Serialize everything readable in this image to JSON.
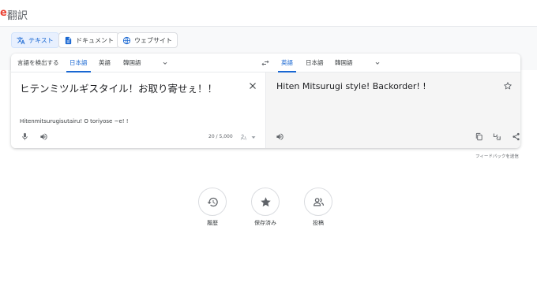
{
  "header": {
    "logo_letter": "e",
    "logo_text": "翻訳"
  },
  "modes": [
    {
      "label": "テキスト",
      "icon": "translate-icon",
      "active": true
    },
    {
      "label": "ドキュメント",
      "icon": "document-icon",
      "active": false
    },
    {
      "label": "ウェブサイト",
      "icon": "globe-icon",
      "active": false
    }
  ],
  "source_langs": [
    "言語を検出する",
    "日本語",
    "英語",
    "韓国語"
  ],
  "target_langs": [
    "英語",
    "日本語",
    "韓国語"
  ],
  "source": {
    "text": "ヒテンミツルギスタイル！お取り寄せぇ！！",
    "romanization": "Hitenmitsurugisutairu! O toriyose ~e! !",
    "char_count": "20 / 5,000"
  },
  "target": {
    "text": "Hiten Mitsurugi style! Backorder! !"
  },
  "feedback": "フィードバックを送信",
  "bottom": [
    {
      "label": "履歴",
      "icon": "history-icon"
    },
    {
      "label": "保存済み",
      "icon": "star-icon"
    },
    {
      "label": "投稿",
      "icon": "community-icon"
    }
  ],
  "colors": {
    "accent": "#1967d2",
    "active_bg": "#e8f0fe",
    "target_bg": "#f5f5f5",
    "logo": "#ea4335"
  }
}
